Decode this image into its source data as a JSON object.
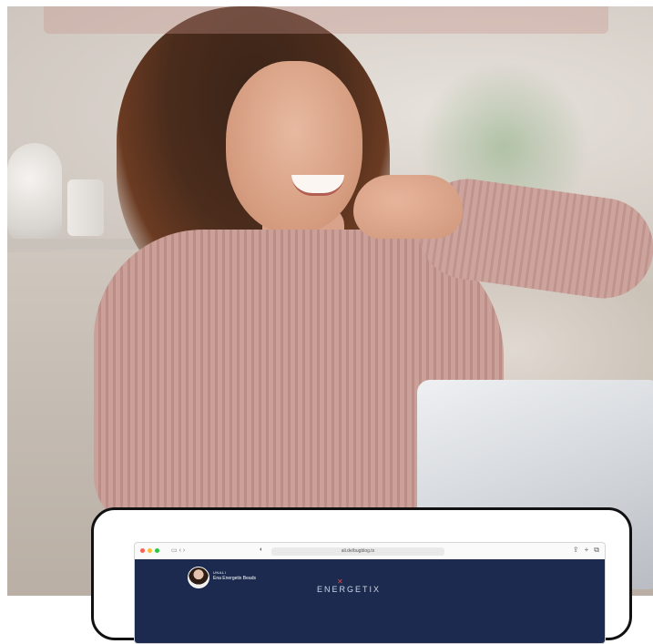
{
  "watermark": {
    "text": ""
  },
  "browser": {
    "url": "ali.de/bugblog.tx",
    "window_controls": [
      "share-icon",
      "plus-icon",
      "tabs-icon"
    ],
    "traffic_colors": [
      "#ff5f57",
      "#febc2e",
      "#28c840"
    ]
  },
  "site": {
    "author_small": "UNALI",
    "author_name": "Ena Energetix Beads",
    "logo_text": "ENERGETIX"
  },
  "colors": {
    "header": "#1b2a4e",
    "logo_mark": "#d14b4b"
  }
}
